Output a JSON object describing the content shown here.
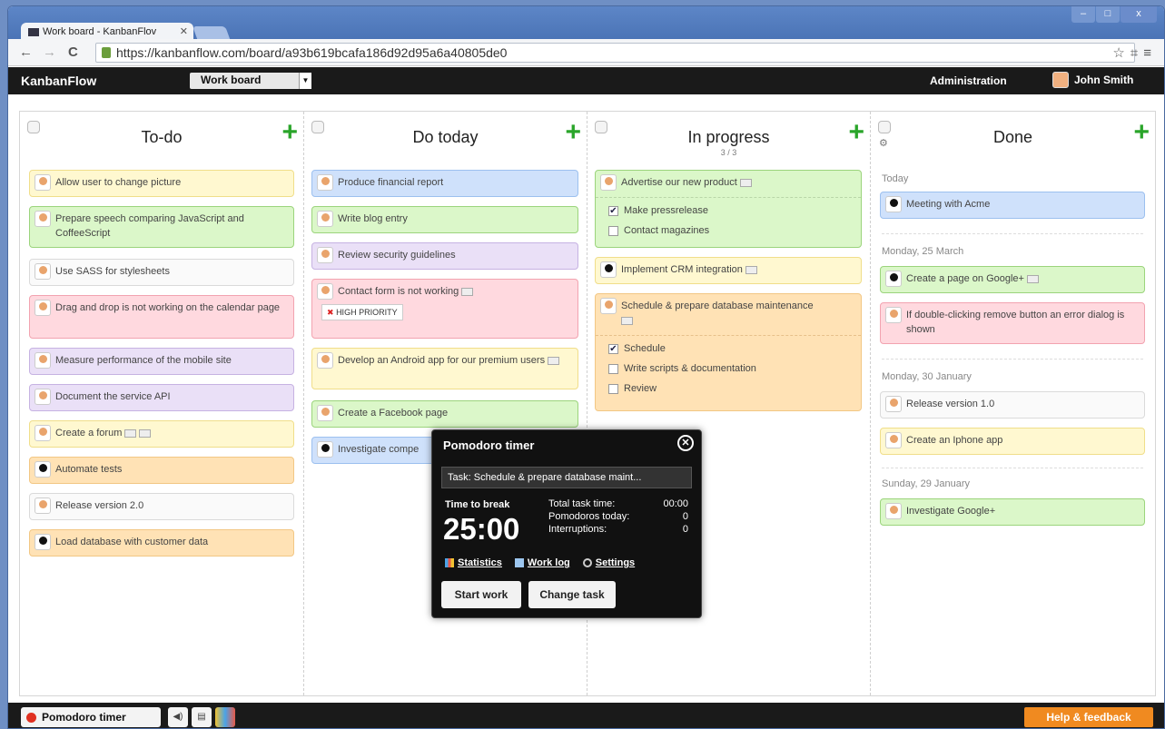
{
  "browser": {
    "tab_title": "Work board - KanbanFlov",
    "url": "https://kanbanflow.com/board/a93b619bcafa186d92d95a6a40805de0"
  },
  "app": {
    "logo": "KanbanFlow",
    "board_select": "Work board",
    "admin_label": "Administration",
    "user_name": "John Smith"
  },
  "columns": [
    {
      "title": "To-do",
      "sub": ""
    },
    {
      "title": "Do today",
      "sub": ""
    },
    {
      "title": "In progress",
      "sub": "3 / 3"
    },
    {
      "title": "Done",
      "sub": ""
    }
  ],
  "todo": [
    "Allow user to change picture",
    "Prepare speech comparing JavaScript and CoffeeScript",
    "Use SASS for stylesheets",
    "Drag and drop is not working on the calendar page",
    "Measure performance of the mobile site",
    "Document the service API",
    "Create a forum",
    "Automate tests",
    "Release version 2.0",
    "Load database with customer data"
  ],
  "today": [
    "Produce financial report",
    "Write blog entry",
    "Review security guidelines",
    "Contact form is not working",
    "Develop an Android app for our premium users",
    "Create a Facebook page",
    "Investigate compe"
  ],
  "priority_label": "HIGH PRIORITY",
  "progress": {
    "c1": "Advertise our new product",
    "c1_sub": [
      "Make pressrelease",
      "Contact magazines"
    ],
    "c2": "Implement CRM integration",
    "c3": "Schedule & prepare database maintenance",
    "c3_sub": [
      "Schedule",
      "Write scripts & documentation",
      "Review"
    ]
  },
  "done": {
    "d1": "Today",
    "d1_items": [
      "Meeting with Acme"
    ],
    "d2": "Monday, 25 March",
    "d2_items": [
      "Create a page on Google+",
      "If double-clicking remove button an error dialog is shown"
    ],
    "d3": "Monday, 30 January",
    "d3_items": [
      "Release version 1.0",
      "Create an Iphone app"
    ],
    "d4": "Sunday, 29 January",
    "d4_items": [
      "Investigate Google+"
    ]
  },
  "pomodoro": {
    "title": "Pomodoro timer",
    "task": "Task:  Schedule & prepare database maint...",
    "time_to_break_label": "Time to break",
    "timer": "25:00",
    "total_label": "Total task time:",
    "total_value": "00:00",
    "today_label": "Pomodoros today:",
    "today_value": "0",
    "interrupt_label": "Interruptions:",
    "interrupt_value": "0",
    "statistics": "Statistics",
    "worklog": "Work log",
    "settings": "Settings",
    "start": "Start work",
    "change": "Change task"
  },
  "footer": {
    "pomodoro_button": "Pomodoro timer",
    "help": "Help & feedback"
  }
}
